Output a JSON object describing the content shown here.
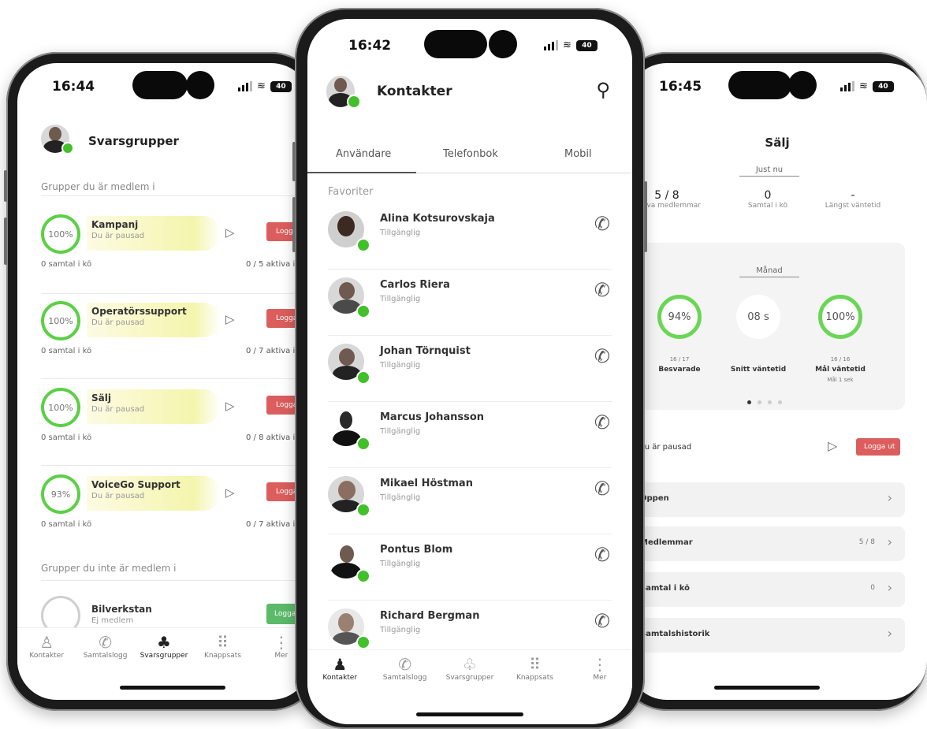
{
  "left_phone": {
    "status": {
      "time": "16:44",
      "battery": "40"
    },
    "title": "Svarsgrupper",
    "section_member": "Grupper du är medlem i",
    "groups": [
      {
        "name": "Kampanj",
        "status": "Du är pausad",
        "percent": "100%",
        "queue": "0 samtal i kö",
        "active": "0 / 5 aktiva i kö",
        "logout": "Logga ut",
        "level": 1.0
      },
      {
        "name": "Operatörssupport",
        "status": "Du är pausad",
        "percent": "100%",
        "queue": "0 samtal i kö",
        "active": "0 / 7 aktiva i kö",
        "logout": "Logga ut",
        "level": 1.0
      },
      {
        "name": "Sälj",
        "status": "Du är pausad",
        "percent": "100%",
        "queue": "0 samtal i kö",
        "active": "0 / 8 aktiva i kö",
        "logout": "Logga ut",
        "level": 1.0
      },
      {
        "name": "VoiceGo Support",
        "status": "Du är pausad",
        "percent": "93%",
        "queue": "0 samtal i kö",
        "active": "0 / 7 aktiva i kö",
        "logout": "Logga ut",
        "level": 0.93
      }
    ],
    "section_not_member": "Grupper du inte är medlem i",
    "other_group": {
      "name": "Bilverkstan",
      "status": "Ej medlem",
      "login": "Logga in"
    },
    "tabs": [
      "Kontakter",
      "Samtalslogg",
      "Svarsgrupper",
      "Knappsats",
      "Mer"
    ],
    "active_tab": "Svarsgrupper"
  },
  "center_phone": {
    "status": {
      "time": "16:42",
      "battery": "40"
    },
    "title": "Kontakter",
    "tabs": [
      "Användare",
      "Telefonbok",
      "Mobil"
    ],
    "section": "Favoriter",
    "contacts": [
      {
        "name": "Alina Kotsurovskaja",
        "status": "Tillgänglig"
      },
      {
        "name": "Carlos Riera",
        "status": "Tillgänglig"
      },
      {
        "name": "Johan Törnquist",
        "status": "Tillgänglig"
      },
      {
        "name": "Marcus Johansson",
        "status": "Tillgänglig"
      },
      {
        "name": "Mikael Höstman",
        "status": "Tillgänglig"
      },
      {
        "name": "Pontus Blom",
        "status": "Tillgänglig"
      },
      {
        "name": "Richard Bergman",
        "status": "Tillgänglig"
      }
    ],
    "bottom_tabs": [
      "Kontakter",
      "Samtalslogg",
      "Svarsgrupper",
      "Knappsats",
      "Mer"
    ],
    "active_tab": "Kontakter"
  },
  "right_phone": {
    "status": {
      "time": "16:45",
      "battery": "40"
    },
    "title": "Sälj",
    "now_label": "Just nu",
    "now_stats": [
      {
        "value": "5 / 8",
        "label": "Aktiva medlemmar"
      },
      {
        "value": "0",
        "label": "Samtal i kö"
      },
      {
        "value": "-",
        "label": "Längst väntetid"
      }
    ],
    "month_label": "Månad",
    "month_stats": [
      {
        "value": "94%",
        "small": "16 / 17",
        "label": "Besvarade"
      },
      {
        "value": "08 s",
        "small": "",
        "label": "Snitt väntetid"
      },
      {
        "value": "100%",
        "small": "16 / 16",
        "label": "Mål väntetid",
        "note": "Mål 1 sek"
      }
    ],
    "paused_text": "Du är pausad",
    "logout": "Logga ut",
    "list": [
      {
        "label": "Öppen",
        "count": ""
      },
      {
        "label": "Medlemmar",
        "count": "5 / 8"
      },
      {
        "label": "Samtal i kö",
        "count": "0"
      },
      {
        "label": "Samtalshistorik",
        "count": ""
      }
    ]
  },
  "colors": {
    "green": "#42c02a",
    "red": "#dc5d5d",
    "login_green": "#5cba6a",
    "yellow_band": "#f4f5ad"
  }
}
